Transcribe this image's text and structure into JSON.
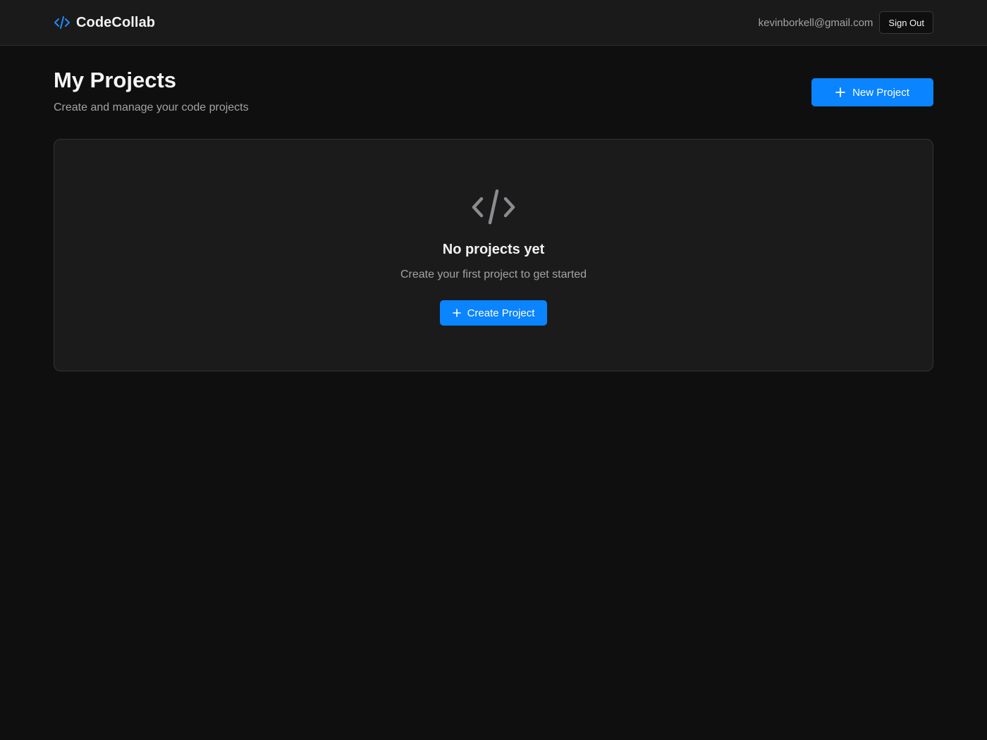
{
  "header": {
    "brand_name": "CodeCollab",
    "brand_icon": "code-icon",
    "user_email": "kevinborkell@gmail.com",
    "sign_out_label": "Sign Out"
  },
  "main": {
    "title": "My Projects",
    "subtitle": "Create and manage your code projects",
    "new_project_label": "New Project",
    "new_project_icon": "plus-icon"
  },
  "empty_state": {
    "icon": "code-icon",
    "title": "No projects yet",
    "description": "Create your first project to get started",
    "create_label": "Create Project",
    "create_icon": "plus-icon"
  },
  "colors": {
    "background": "#0f0f10",
    "surface": "#1b1b1c",
    "accent": "#0a84ff",
    "text_primary": "#f2f2f2",
    "text_secondary": "#a3a3a6",
    "border": "#333336"
  }
}
